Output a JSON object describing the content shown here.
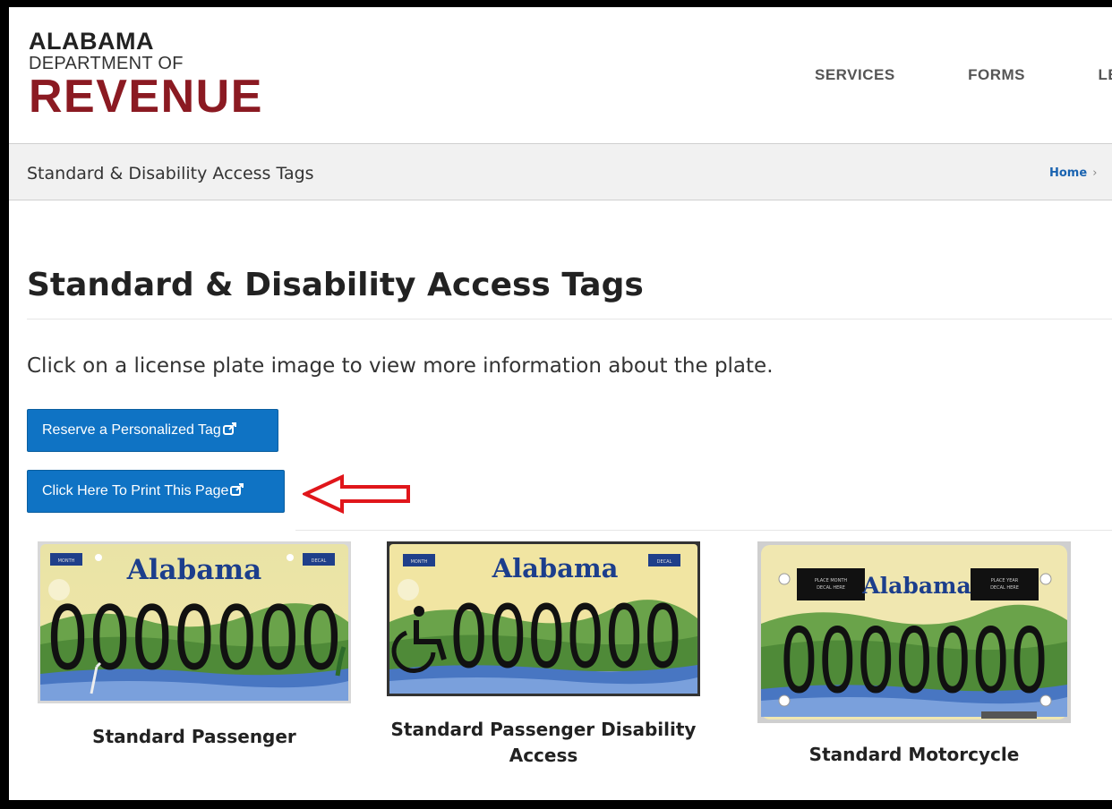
{
  "logo": {
    "line1": "ALABAMA",
    "line2": "DEPARTMENT OF",
    "line3": "REVENUE"
  },
  "nav": {
    "items": [
      "SERVICES",
      "FORMS",
      "LE"
    ]
  },
  "breadcrumb": {
    "title": "Standard & Disability Access Tags",
    "home": "Home",
    "separator": "›"
  },
  "main": {
    "title": "Standard & Disability Access Tags",
    "intro": "Click on a license plate image to view more information about the plate.",
    "buttons": {
      "reserve": "Reserve a Personalized Tag",
      "print": "Click Here To Print This Page"
    }
  },
  "plates": [
    {
      "label": "Standard Passenger",
      "state": "Alabama",
      "number": "0000000",
      "decal_left": "MONTH",
      "decal_right": "DECAL"
    },
    {
      "label_line1": "Standard Passenger Disability",
      "label_line2": "Access",
      "state": "Alabama",
      "number": "000000",
      "decal_left": "MONTH",
      "decal_right": "DECAL"
    },
    {
      "label": "Standard Motorcycle",
      "state": "Alabama",
      "number": "0000000",
      "decal_left_line1": "PLACE MONTH",
      "decal_left_line2": "DECAL HERE",
      "decal_right_line1": "PLACE YEAR",
      "decal_right_line2": "DECAL HERE"
    }
  ],
  "colors": {
    "brand_red": "#8b1a22",
    "button_blue": "#0f73c4",
    "link_blue": "#1a63b0",
    "annotation_red": "#e0161b"
  },
  "icons": [
    "external-link-icon",
    "wheelchair-icon",
    "red-arrow-icon"
  ]
}
